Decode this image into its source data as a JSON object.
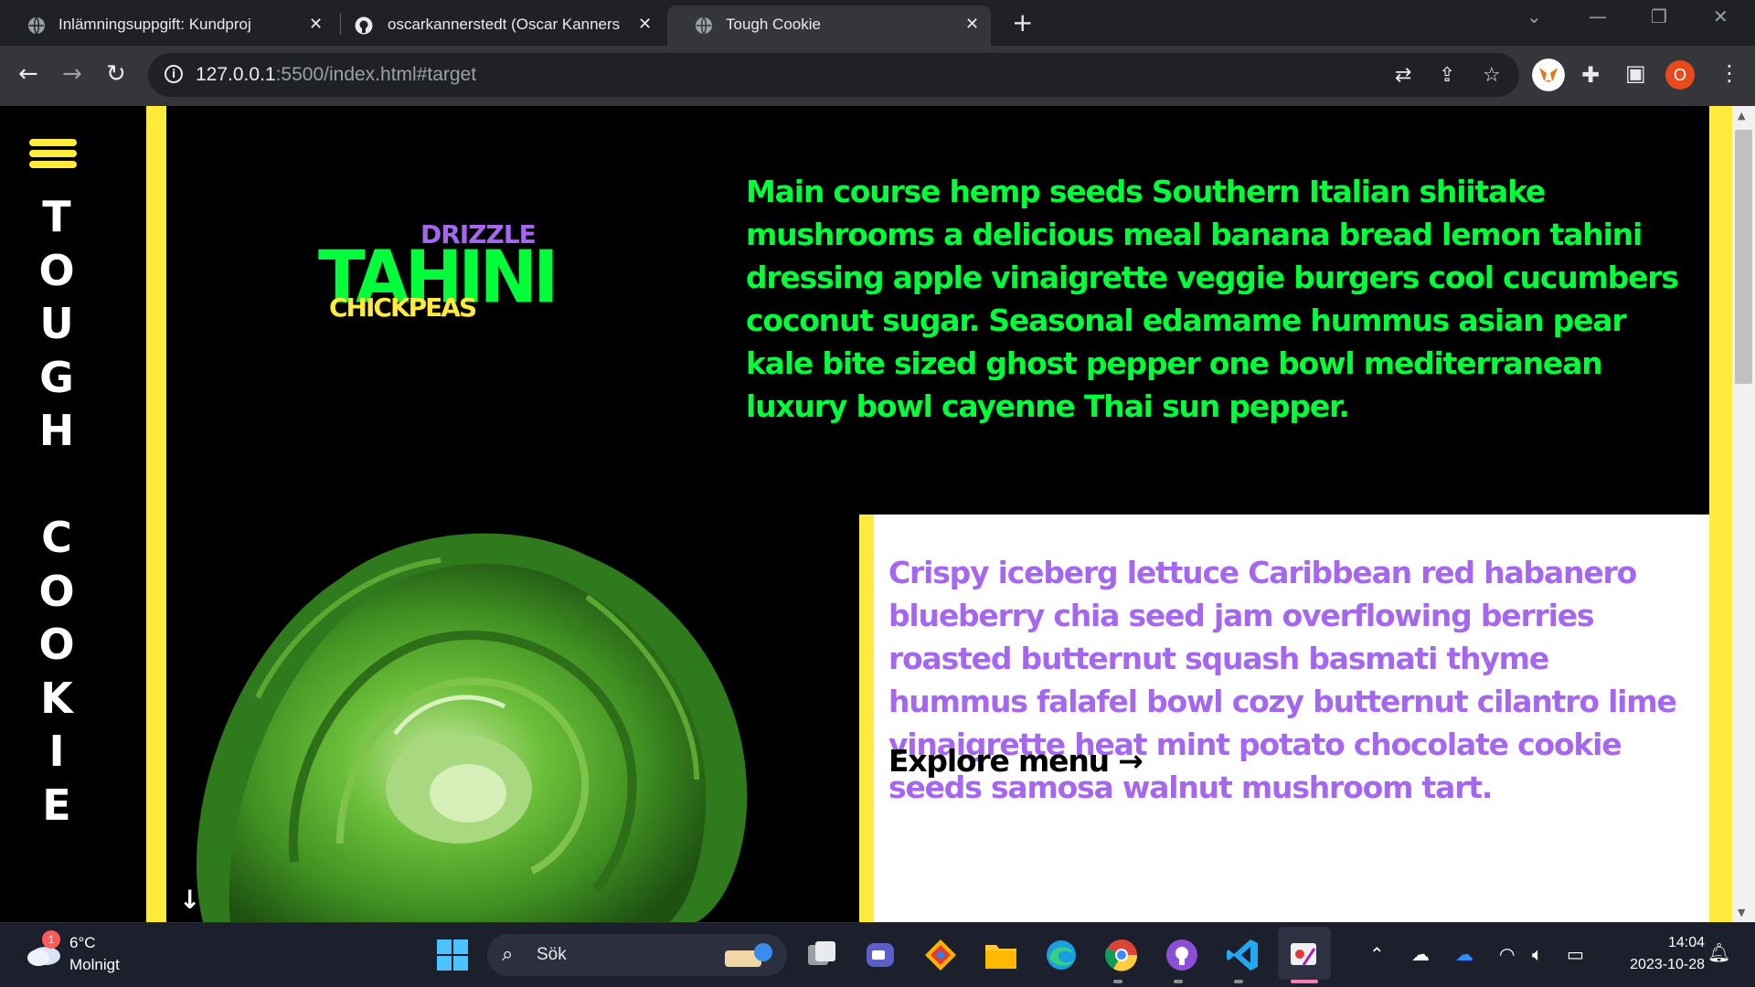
{
  "browser": {
    "tabs": [
      {
        "title": "Inlämningsuppgift: Kundprojekt",
        "active": false,
        "icon": "globe-icon"
      },
      {
        "title": "oscarkannerstedt (Oscar Kanners",
        "active": false,
        "icon": "github-icon"
      },
      {
        "title": "Tough Cookie",
        "active": true,
        "icon": "globe-icon"
      }
    ],
    "tab_close": "✕",
    "new_tab": "+",
    "url_host": "127.0.0.1",
    "url_rest": ":5500/index.html#target",
    "profile_initial": "O"
  },
  "page": {
    "site_title_letters": [
      "T",
      "O",
      "U",
      "G",
      "H",
      " ",
      "C",
      "O",
      "O",
      "K",
      "I",
      "E"
    ],
    "logo": {
      "top": "DRIZZLE",
      "main": "TAHINI",
      "bottom": "CHICKPEAS"
    },
    "intro_text": "Main course hemp seeds Southern Italian shiitake mushrooms a delicious meal banana bread lemon tahini dressing apple vinaigrette veggie burgers cool cucumbers coconut sugar. Seasonal edamame hummus asian pear kale bite sized ghost pepper one bowl mediterranean luxury bowl cayenne Thai sun pepper.",
    "feature_text": "Crispy iceberg lettuce Caribbean red habanero blueberry chia seed jam overflowing berries roasted butternut squash basmati thyme hummus falafel bowl cozy butternut cilantro lime vinaigrette heat mint potato chocolate cookie seeds samosa walnut mushroom tart.",
    "explore_link": "Explore menu →",
    "scroll_down": "↓"
  },
  "taskbar": {
    "weather_temp": "6°C",
    "weather_desc": "Molnigt",
    "weather_badge": "1",
    "search_placeholder": "Sök",
    "time": "14:04",
    "date": "2023-10-28"
  },
  "colors": {
    "accent_yellow": "#ffeb3b",
    "accent_green": "#00ff3a",
    "accent_purple": "#a567f0"
  }
}
